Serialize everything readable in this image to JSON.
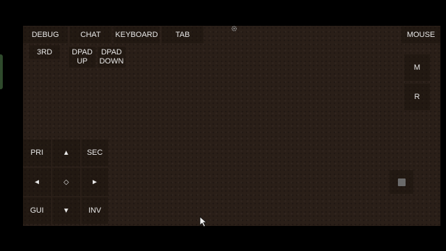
{
  "top_bar": {
    "debug": "DEBUG",
    "chat": "CHAT",
    "keyboard": "KEYBOARD",
    "tab": "TAB",
    "mouse": "MOUSE"
  },
  "row2": {
    "third_person": "3RD",
    "dpad_up": "DPAD\nUP",
    "dpad_down": "DPAD\nDOWN"
  },
  "right_column": {
    "m": "M",
    "r": "R"
  },
  "dpad": {
    "pri": "PRI",
    "up": "▲",
    "sec": "SEC",
    "left": "◄",
    "center": "◇",
    "right": "►",
    "gui": "GUI",
    "down": "▼",
    "inv": "INV"
  },
  "icons": {
    "settings": "gear-icon",
    "joystick": "joystick-icon",
    "cursor": "mouse-pointer-icon"
  },
  "colors": {
    "background": "#2a1f18",
    "text": "#e9e9e9",
    "accent_green": "#2f4a2c"
  }
}
